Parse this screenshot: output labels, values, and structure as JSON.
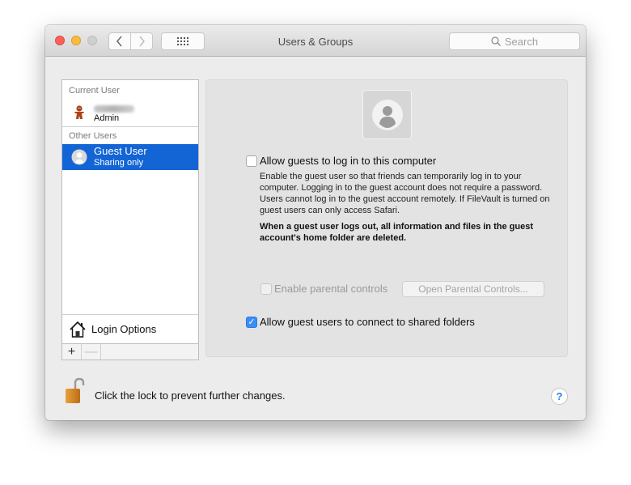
{
  "window": {
    "title": "Users & Groups",
    "search_placeholder": "Search"
  },
  "sidebar": {
    "current_user_header": "Current User",
    "current_user": {
      "name_redacted": true,
      "role": "Admin",
      "icon": "gingerbread-man-icon"
    },
    "other_users_header": "Other Users",
    "other_users": [
      {
        "name": "Guest User",
        "subtitle": "Sharing only",
        "selected": true,
        "icon": "user-silhouette-icon"
      }
    ],
    "login_options_label": "Login Options",
    "add_label": "+",
    "remove_label": "—"
  },
  "panel": {
    "allow_guests_login": {
      "label": "Allow guests to log in to this computer",
      "checked": false
    },
    "description": "Enable the guest user so that friends can temporarily log in to your computer. Logging in to the guest account does not require a password. Users cannot log in to the guest account remotely. If FileVault is turned on guest users can only access Safari.",
    "warning": "When a guest user logs out, all information and files in the guest account's home folder are deleted.",
    "parental_controls": {
      "label": "Enable parental controls",
      "checked": false,
      "enabled": false
    },
    "open_parental_controls_label": "Open Parental Controls...",
    "shared_folders": {
      "label": "Allow guest users to connect to shared folders",
      "checked": true
    }
  },
  "footer": {
    "lock_text": "Click the lock to prevent further changes.",
    "lock_state": "unlocked",
    "help_label": "?"
  },
  "colors": {
    "selection": "#1365d6",
    "checkbox_checked": "#3b8ef5",
    "close": "#fc605b",
    "minimize": "#fdbc40"
  }
}
